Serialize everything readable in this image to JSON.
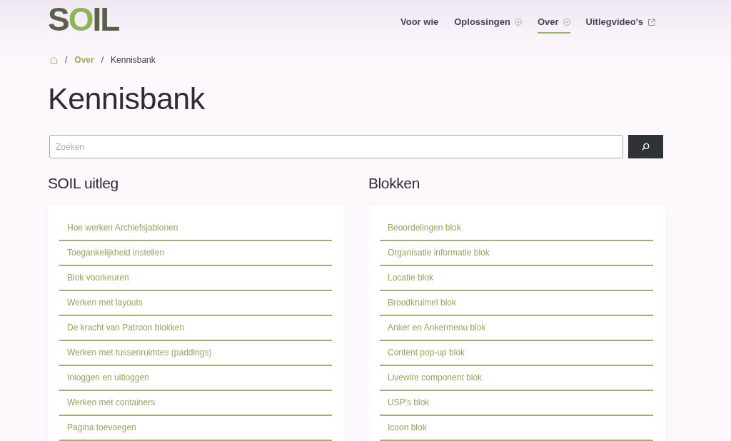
{
  "header": {
    "logo": "SOIL",
    "nav": [
      {
        "label": "Voor wie",
        "kind": "link",
        "selected": false
      },
      {
        "label": "Oplossingen",
        "kind": "dropdown",
        "selected": false
      },
      {
        "label": "Over",
        "kind": "dropdown",
        "selected": true
      },
      {
        "label": "Uitlegvideo's",
        "kind": "external",
        "selected": false
      }
    ]
  },
  "breadcrumb": [
    {
      "kind": "home"
    },
    {
      "kind": "separator",
      "text": "/"
    },
    {
      "kind": "link",
      "label": "Over"
    },
    {
      "kind": "separator",
      "text": "/"
    },
    {
      "kind": "current",
      "label": "Kennisbank"
    }
  ],
  "title": "Kennisbank",
  "search": {
    "placeholder": "Zoeken"
  },
  "sections": [
    {
      "title": "SOIL uitleg",
      "items": [
        "Hoe werken Archiefsjablonen",
        "Toegankelijkheid instellen",
        "Blok voorkeuren",
        "Werken met layouts",
        "De kracht van Patroon blokken",
        "Werken met tussenruimtes (paddings)",
        "Inloggen en uitloggen",
        "Werken met containers",
        "Pagina toevoegen"
      ]
    },
    {
      "title": "Blokken",
      "items": [
        "Beoordelingen blok",
        "Organisatie informatie blok",
        "Locatie blok",
        "Broodkruimel blok",
        "Anker en Ankermenu blok",
        "Content pop-up blok",
        "Livewire component blok",
        "USP's blok",
        "Icoon blok"
      ]
    }
  ]
}
